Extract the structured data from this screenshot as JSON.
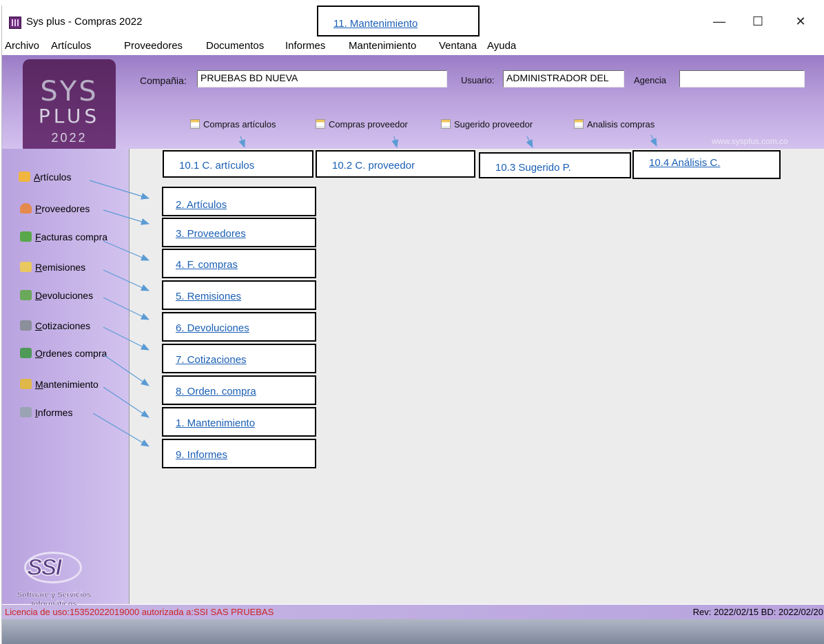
{
  "window": {
    "title": "Sys plus - Compras 2022",
    "minimize": "—",
    "maximize": "☐",
    "close": "✕"
  },
  "menu": [
    "Archivo",
    "Artículos",
    "Proveedores",
    "Documentos",
    "Informes",
    "Mantenimiento",
    "Ventana",
    "Ayuda"
  ],
  "logo": {
    "line1": "SYS",
    "line2": "PLUS",
    "line3": "2022"
  },
  "header": {
    "company_label": "Compañia:",
    "company_value": "PRUEBAS BD NUEVA",
    "user_label": "Usuario:",
    "user_value": "ADMINISTRADOR DEL",
    "agency_label": "Agencia",
    "agency_value": "",
    "website": "www.sysplus.com.co"
  },
  "quick_buttons": [
    "Compras artículos",
    "Compras proveedor",
    "Sugerido proveedor",
    "Analisis compras"
  ],
  "sidebar": [
    {
      "label": "Artículos",
      "accel": "A",
      "rest": "rtículos",
      "icon": "box-icon"
    },
    {
      "label": "Proveedores",
      "accel": "P",
      "rest": "roveedores",
      "icon": "person-icon"
    },
    {
      "label": "Facturas compra",
      "accel": "F",
      "rest": "acturas compra",
      "icon": "invoice-icon"
    },
    {
      "label": "Remisiones",
      "accel": "R",
      "rest": "emisiones",
      "icon": "pencil-icon"
    },
    {
      "label": "Devoluciones",
      "accel": "D",
      "rest": "evoluciones",
      "icon": "return-icon"
    },
    {
      "label": "Cotizaciones",
      "accel": "C",
      "rest": "otizaciones",
      "icon": "calculator-icon"
    },
    {
      "label": "Ordenes compra",
      "accel": "O",
      "rest": "rdenes compra",
      "icon": "order-icon"
    },
    {
      "label": "Mantenimiento",
      "accel": "M",
      "rest": "antenimiento",
      "icon": "tools-icon"
    },
    {
      "label": "Informes",
      "accel": "I",
      "rest": "nformes",
      "icon": "printer-icon"
    }
  ],
  "ssi_logo": {
    "mark": "SSI",
    "caption_line1": "Software y Servicios",
    "caption_line2": "Informáticos"
  },
  "status": {
    "license": "Licencia de uso:15352022019000 autorizada a:SSI SAS PRUEBAS",
    "revision": "Rev: 2022/02/15 BD: 2022/02/20"
  },
  "annotations": {
    "title_box": "11. Mantenimiento",
    "top": [
      "10.1 C. artículos",
      "10.2 C. proveedor",
      "10.3 Sugerido P.",
      "10.4 Análisis C."
    ],
    "side": [
      "2. Artículos",
      "3. Proveedores",
      "4. F. compras",
      "5. Remisiones",
      "6. Devoluciones",
      "7. Cotizaciones",
      "8. Orden. compra",
      "1. Mantenimiento",
      "9. Informes"
    ]
  },
  "colors": {
    "header_purple": "#9a7cc6",
    "sidebar_purple": "#c8b5e8",
    "link_blue": "#1a5fb4",
    "license_red": "#cc2222"
  }
}
